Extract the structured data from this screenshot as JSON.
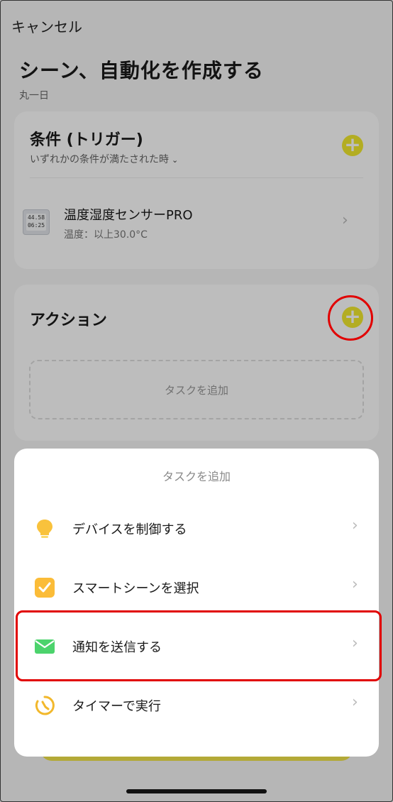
{
  "header": {
    "cancel_label": "キャンセル",
    "title": "シーン、自動化を作成する",
    "subtitle": "丸一日"
  },
  "condition": {
    "title": "条件 (トリガー)",
    "subtitle": "いずれかの条件が満たされた時",
    "device": {
      "name": "温度湿度センサーPRO",
      "condition": "温度：以上30.0°C",
      "display_top": "44.58",
      "display_bottom": "06:25"
    }
  },
  "action": {
    "title": "アクション",
    "placeholder": "タスクを追加"
  },
  "sheet": {
    "title": "タスクを追加",
    "items": [
      {
        "label": "デバイスを制御する",
        "icon": "lightbulb-icon"
      },
      {
        "label": "スマートシーンを選択",
        "icon": "checkbox-icon"
      },
      {
        "label": "通知を送信する",
        "icon": "envelope-icon"
      },
      {
        "label": "タイマーで実行",
        "icon": "timer-icon"
      }
    ]
  },
  "colors": {
    "accent": "#f2ea2e",
    "highlight": "#e10000",
    "bulb": "#f9c23c",
    "checkbox": "#fbbc38",
    "envelope": "#4cd36c",
    "timer": "#f2b82c"
  },
  "icons": {
    "plus": "+",
    "chevron": "›",
    "chevron_down": "⌄"
  }
}
